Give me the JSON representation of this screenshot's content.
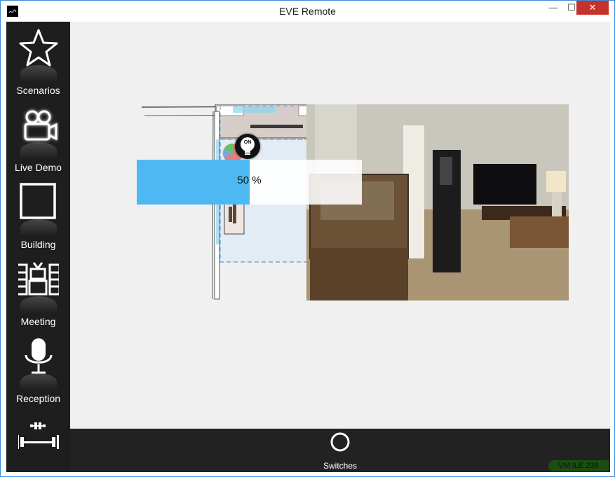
{
  "window": {
    "title": "EVE Remote",
    "minimize_glyph": "—",
    "maximize_glyph": "☐",
    "close_glyph": "✕"
  },
  "sidebar": {
    "items": [
      {
        "label": "Scenarios",
        "icon": "star-icon"
      },
      {
        "label": "Live Demo",
        "icon": "video-camera-icon"
      },
      {
        "label": "Building",
        "icon": "square-icon"
      },
      {
        "label": "Meeting",
        "icon": "tv-room-icon"
      },
      {
        "label": "Reception",
        "icon": "microphone-icon"
      },
      {
        "label": "",
        "icon": "dumbbell-icon"
      }
    ]
  },
  "main": {
    "light": {
      "state_label": "ON"
    },
    "dimmer": {
      "value": 50,
      "label": "50 %"
    }
  },
  "bottombar": {
    "switches_label": "Switches",
    "status": "VM ILE 238"
  },
  "colors": {
    "accent_blue": "#3fb2f2",
    "sidebar_bg": "#1e1e1e",
    "status_green": "#1b4d12",
    "close_red": "#c7312b"
  }
}
